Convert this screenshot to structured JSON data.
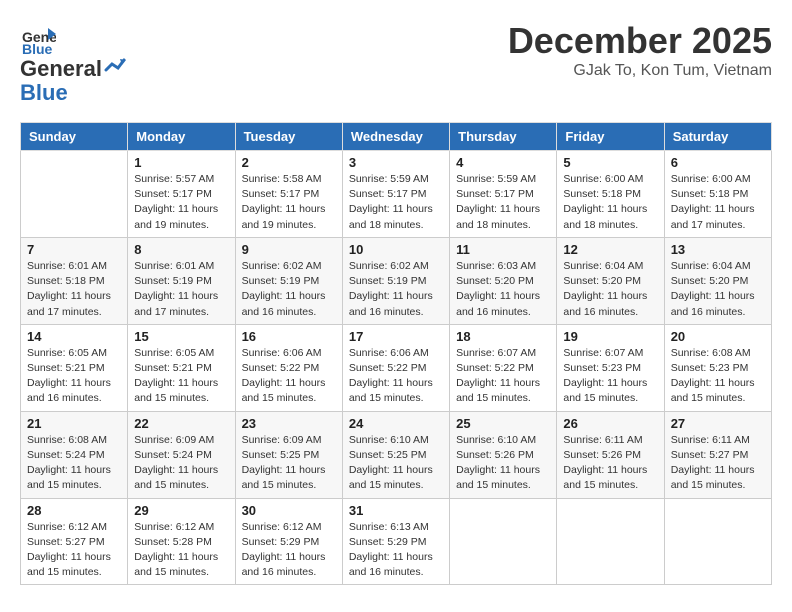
{
  "logo": {
    "general": "General",
    "blue": "Blue"
  },
  "title": "December 2025",
  "location": "GJak To, Kon Tum, Vietnam",
  "days_header": [
    "Sunday",
    "Monday",
    "Tuesday",
    "Wednesday",
    "Thursday",
    "Friday",
    "Saturday"
  ],
  "weeks": [
    [
      {
        "day": "",
        "info": ""
      },
      {
        "day": "1",
        "info": "Sunrise: 5:57 AM\nSunset: 5:17 PM\nDaylight: 11 hours\nand 19 minutes."
      },
      {
        "day": "2",
        "info": "Sunrise: 5:58 AM\nSunset: 5:17 PM\nDaylight: 11 hours\nand 19 minutes."
      },
      {
        "day": "3",
        "info": "Sunrise: 5:59 AM\nSunset: 5:17 PM\nDaylight: 11 hours\nand 18 minutes."
      },
      {
        "day": "4",
        "info": "Sunrise: 5:59 AM\nSunset: 5:17 PM\nDaylight: 11 hours\nand 18 minutes."
      },
      {
        "day": "5",
        "info": "Sunrise: 6:00 AM\nSunset: 5:18 PM\nDaylight: 11 hours\nand 18 minutes."
      },
      {
        "day": "6",
        "info": "Sunrise: 6:00 AM\nSunset: 5:18 PM\nDaylight: 11 hours\nand 17 minutes."
      }
    ],
    [
      {
        "day": "7",
        "info": "Sunrise: 6:01 AM\nSunset: 5:18 PM\nDaylight: 11 hours\nand 17 minutes."
      },
      {
        "day": "8",
        "info": "Sunrise: 6:01 AM\nSunset: 5:19 PM\nDaylight: 11 hours\nand 17 minutes."
      },
      {
        "day": "9",
        "info": "Sunrise: 6:02 AM\nSunset: 5:19 PM\nDaylight: 11 hours\nand 16 minutes."
      },
      {
        "day": "10",
        "info": "Sunrise: 6:02 AM\nSunset: 5:19 PM\nDaylight: 11 hours\nand 16 minutes."
      },
      {
        "day": "11",
        "info": "Sunrise: 6:03 AM\nSunset: 5:20 PM\nDaylight: 11 hours\nand 16 minutes."
      },
      {
        "day": "12",
        "info": "Sunrise: 6:04 AM\nSunset: 5:20 PM\nDaylight: 11 hours\nand 16 minutes."
      },
      {
        "day": "13",
        "info": "Sunrise: 6:04 AM\nSunset: 5:20 PM\nDaylight: 11 hours\nand 16 minutes."
      }
    ],
    [
      {
        "day": "14",
        "info": "Sunrise: 6:05 AM\nSunset: 5:21 PM\nDaylight: 11 hours\nand 16 minutes."
      },
      {
        "day": "15",
        "info": "Sunrise: 6:05 AM\nSunset: 5:21 PM\nDaylight: 11 hours\nand 15 minutes."
      },
      {
        "day": "16",
        "info": "Sunrise: 6:06 AM\nSunset: 5:22 PM\nDaylight: 11 hours\nand 15 minutes."
      },
      {
        "day": "17",
        "info": "Sunrise: 6:06 AM\nSunset: 5:22 PM\nDaylight: 11 hours\nand 15 minutes."
      },
      {
        "day": "18",
        "info": "Sunrise: 6:07 AM\nSunset: 5:22 PM\nDaylight: 11 hours\nand 15 minutes."
      },
      {
        "day": "19",
        "info": "Sunrise: 6:07 AM\nSunset: 5:23 PM\nDaylight: 11 hours\nand 15 minutes."
      },
      {
        "day": "20",
        "info": "Sunrise: 6:08 AM\nSunset: 5:23 PM\nDaylight: 11 hours\nand 15 minutes."
      }
    ],
    [
      {
        "day": "21",
        "info": "Sunrise: 6:08 AM\nSunset: 5:24 PM\nDaylight: 11 hours\nand 15 minutes."
      },
      {
        "day": "22",
        "info": "Sunrise: 6:09 AM\nSunset: 5:24 PM\nDaylight: 11 hours\nand 15 minutes."
      },
      {
        "day": "23",
        "info": "Sunrise: 6:09 AM\nSunset: 5:25 PM\nDaylight: 11 hours\nand 15 minutes."
      },
      {
        "day": "24",
        "info": "Sunrise: 6:10 AM\nSunset: 5:25 PM\nDaylight: 11 hours\nand 15 minutes."
      },
      {
        "day": "25",
        "info": "Sunrise: 6:10 AM\nSunset: 5:26 PM\nDaylight: 11 hours\nand 15 minutes."
      },
      {
        "day": "26",
        "info": "Sunrise: 6:11 AM\nSunset: 5:26 PM\nDaylight: 11 hours\nand 15 minutes."
      },
      {
        "day": "27",
        "info": "Sunrise: 6:11 AM\nSunset: 5:27 PM\nDaylight: 11 hours\nand 15 minutes."
      }
    ],
    [
      {
        "day": "28",
        "info": "Sunrise: 6:12 AM\nSunset: 5:27 PM\nDaylight: 11 hours\nand 15 minutes."
      },
      {
        "day": "29",
        "info": "Sunrise: 6:12 AM\nSunset: 5:28 PM\nDaylight: 11 hours\nand 15 minutes."
      },
      {
        "day": "30",
        "info": "Sunrise: 6:12 AM\nSunset: 5:29 PM\nDaylight: 11 hours\nand 16 minutes."
      },
      {
        "day": "31",
        "info": "Sunrise: 6:13 AM\nSunset: 5:29 PM\nDaylight: 11 hours\nand 16 minutes."
      },
      {
        "day": "",
        "info": ""
      },
      {
        "day": "",
        "info": ""
      },
      {
        "day": "",
        "info": ""
      }
    ]
  ]
}
